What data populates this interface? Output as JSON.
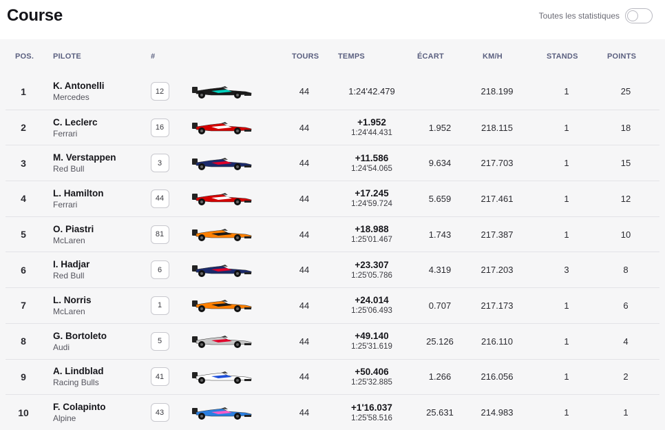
{
  "header": {
    "title": "Course",
    "toggle_label": "Toutes les statistiques"
  },
  "columns": {
    "pos": "POS.",
    "driver": "PILOTE",
    "number": "#",
    "laps": "TOURS",
    "time": "TEMPS",
    "gap": "ÉCART",
    "speed": "KM/H",
    "stops": "STANDS",
    "points": "POINTS"
  },
  "rows": [
    {
      "pos": "1",
      "name": "K. Antonelli",
      "team": "Mercedes",
      "number": "12",
      "car_icon": "car-icon-mercedes",
      "car_color": "#1a1a1a",
      "car_accent": "#00d2be",
      "laps": "44",
      "gap": "",
      "time": "1:24'42.479",
      "ecart": "",
      "speed": "218.199",
      "stops": "1",
      "points": "25"
    },
    {
      "pos": "2",
      "name": "C. Leclerc",
      "team": "Ferrari",
      "number": "16",
      "car_icon": "car-icon-ferrari",
      "car_color": "#d40000",
      "car_accent": "#ffffff",
      "laps": "44",
      "gap": "+1.952",
      "time": "1:24'44.431",
      "ecart": "1.952",
      "speed": "218.115",
      "stops": "1",
      "points": "18"
    },
    {
      "pos": "3",
      "name": "M. Verstappen",
      "team": "Red Bull",
      "number": "3",
      "car_icon": "car-icon-redbull",
      "car_color": "#1b2a6b",
      "car_accent": "#e0002a",
      "laps": "44",
      "gap": "+11.586",
      "time": "1:24'54.065",
      "ecart": "9.634",
      "speed": "217.703",
      "stops": "1",
      "points": "15"
    },
    {
      "pos": "4",
      "name": "L. Hamilton",
      "team": "Ferrari",
      "number": "44",
      "car_icon": "car-icon-ferrari",
      "car_color": "#d40000",
      "car_accent": "#ffffff",
      "laps": "44",
      "gap": "+17.245",
      "time": "1:24'59.724",
      "ecart": "5.659",
      "speed": "217.461",
      "stops": "1",
      "points": "12"
    },
    {
      "pos": "5",
      "name": "O. Piastri",
      "team": "McLaren",
      "number": "81",
      "car_icon": "car-icon-mclaren",
      "car_color": "#ff8000",
      "car_accent": "#1a1a1a",
      "laps": "44",
      "gap": "+18.988",
      "time": "1:25'01.467",
      "ecart": "1.743",
      "speed": "217.387",
      "stops": "1",
      "points": "10"
    },
    {
      "pos": "6",
      "name": "I. Hadjar",
      "team": "Red Bull",
      "number": "6",
      "car_icon": "car-icon-redbull",
      "car_color": "#1b2a6b",
      "car_accent": "#e0002a",
      "laps": "44",
      "gap": "+23.307",
      "time": "1:25'05.786",
      "ecart": "4.319",
      "speed": "217.203",
      "stops": "3",
      "points": "8"
    },
    {
      "pos": "7",
      "name": "L. Norris",
      "team": "McLaren",
      "number": "1",
      "car_icon": "car-icon-mclaren",
      "car_color": "#ff8000",
      "car_accent": "#1a1a1a",
      "laps": "44",
      "gap": "+24.014",
      "time": "1:25'06.493",
      "ecart": "0.707",
      "speed": "217.173",
      "stops": "1",
      "points": "6"
    },
    {
      "pos": "8",
      "name": "G. Bortoleto",
      "team": "Audi",
      "number": "5",
      "car_icon": "car-icon-audi",
      "car_color": "#c8c8c8",
      "car_accent": "#e0002a",
      "laps": "44",
      "gap": "+49.140",
      "time": "1:25'31.619",
      "ecart": "25.126",
      "speed": "216.110",
      "stops": "1",
      "points": "4"
    },
    {
      "pos": "9",
      "name": "A. Lindblad",
      "team": "Racing Bulls",
      "number": "41",
      "car_icon": "car-icon-racingbulls",
      "car_color": "#ffffff",
      "car_accent": "#1f4fd8",
      "laps": "44",
      "gap": "+50.406",
      "time": "1:25'32.885",
      "ecart": "1.266",
      "speed": "216.056",
      "stops": "1",
      "points": "2"
    },
    {
      "pos": "10",
      "name": "F. Colapinto",
      "team": "Alpine",
      "number": "43",
      "car_icon": "car-icon-alpine",
      "car_color": "#2b7fe0",
      "car_accent": "#ff5cc8",
      "laps": "44",
      "gap": "+1'16.037",
      "time": "1:25'58.516",
      "ecart": "25.631",
      "speed": "214.983",
      "stops": "1",
      "points": "1"
    }
  ]
}
